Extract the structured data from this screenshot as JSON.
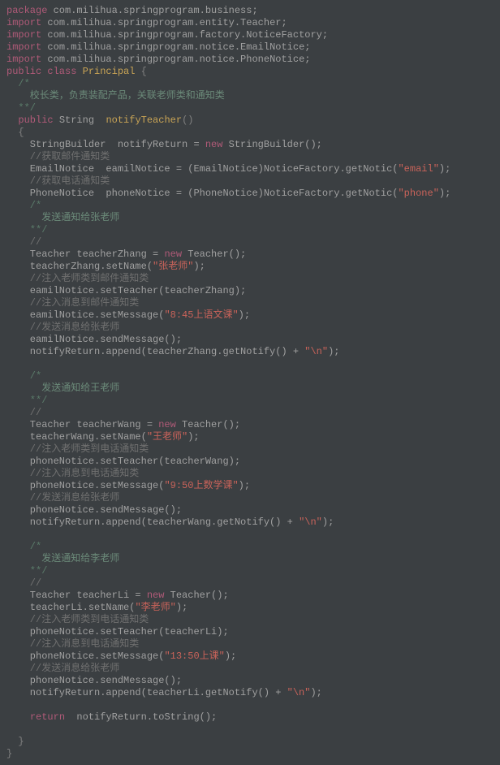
{
  "lines": [
    {
      "segments": [
        {
          "t": "package ",
          "c": "kw"
        },
        {
          "t": "com.milihua.springprogram.business;",
          "c": "pkg"
        }
      ]
    },
    {
      "segments": [
        {
          "t": "import ",
          "c": "kw"
        },
        {
          "t": "com.milihua.springprogram.entity.Teacher;",
          "c": "pkg"
        }
      ]
    },
    {
      "segments": [
        {
          "t": "import ",
          "c": "kw"
        },
        {
          "t": "com.milihua.springprogram.factory.NoticeFactory;",
          "c": "pkg"
        }
      ]
    },
    {
      "segments": [
        {
          "t": "import ",
          "c": "kw"
        },
        {
          "t": "com.milihua.springprogram.notice.EmailNotice;",
          "c": "pkg"
        }
      ]
    },
    {
      "segments": [
        {
          "t": "import ",
          "c": "kw"
        },
        {
          "t": "com.milihua.springprogram.notice.PhoneNotice;",
          "c": "pkg"
        }
      ]
    },
    {
      "segments": [
        {
          "t": "public class ",
          "c": "kw"
        },
        {
          "t": "Principal",
          "c": "cls"
        },
        {
          "t": " {",
          "c": "punc"
        }
      ]
    },
    {
      "segments": [
        {
          "t": "  /*",
          "c": "cmtblock"
        }
      ]
    },
    {
      "segments": [
        {
          "t": "    校长类，负责装配产品，关联老师类和通知类",
          "c": "cmtzh"
        }
      ]
    },
    {
      "segments": [
        {
          "t": "  **/",
          "c": "cmtblock"
        }
      ]
    },
    {
      "segments": [
        {
          "t": "  ",
          "c": "ident"
        },
        {
          "t": "public",
          "c": "kw"
        },
        {
          "t": " String  ",
          "c": "ident"
        },
        {
          "t": "notifyTeacher",
          "c": "cls"
        },
        {
          "t": "()",
          "c": "punc"
        }
      ]
    },
    {
      "segments": [
        {
          "t": "  {",
          "c": "punc"
        }
      ]
    },
    {
      "segments": [
        {
          "t": "    StringBuilder  notifyReturn = ",
          "c": "ident"
        },
        {
          "t": "new",
          "c": "kw"
        },
        {
          "t": " StringBuilder();",
          "c": "ident"
        }
      ]
    },
    {
      "segments": [
        {
          "t": "    //获取邮件通知类",
          "c": "cmtline"
        }
      ]
    },
    {
      "segments": [
        {
          "t": "    EmailNotice  eamilNotice = (EmailNotice)NoticeFactory.getNotic(",
          "c": "ident"
        },
        {
          "t": "\"email\"",
          "c": "str"
        },
        {
          "t": ");",
          "c": "ident"
        }
      ]
    },
    {
      "segments": [
        {
          "t": "    //获取电话通知类",
          "c": "cmtline"
        }
      ]
    },
    {
      "segments": [
        {
          "t": "    PhoneNotice  phoneNotice = (PhoneNotice)NoticeFactory.getNotic(",
          "c": "ident"
        },
        {
          "t": "\"phone\"",
          "c": "str"
        },
        {
          "t": ");",
          "c": "ident"
        }
      ]
    },
    {
      "segments": [
        {
          "t": "    /*",
          "c": "cmtblock"
        }
      ]
    },
    {
      "segments": [
        {
          "t": "      发送通知给张老师",
          "c": "cmtzh"
        }
      ]
    },
    {
      "segments": [
        {
          "t": "    **/",
          "c": "cmtblock"
        }
      ]
    },
    {
      "segments": [
        {
          "t": "    //",
          "c": "cmtline"
        }
      ]
    },
    {
      "segments": [
        {
          "t": "    Teacher teacherZhang = ",
          "c": "ident"
        },
        {
          "t": "new",
          "c": "kw"
        },
        {
          "t": " Teacher();",
          "c": "ident"
        }
      ]
    },
    {
      "segments": [
        {
          "t": "    teacherZhang.setName(",
          "c": "ident"
        },
        {
          "t": "\"张老师\"",
          "c": "str"
        },
        {
          "t": ");",
          "c": "ident"
        }
      ]
    },
    {
      "segments": [
        {
          "t": "    //注入老师类到邮件通知类",
          "c": "cmtline"
        }
      ]
    },
    {
      "segments": [
        {
          "t": "    eamilNotice.setTeacher(teacherZhang);",
          "c": "ident"
        }
      ]
    },
    {
      "segments": [
        {
          "t": "    //注入消息到邮件通知类",
          "c": "cmtline"
        }
      ]
    },
    {
      "segments": [
        {
          "t": "    eamilNotice.setMessage(",
          "c": "ident"
        },
        {
          "t": "\"8:45上语文课\"",
          "c": "str"
        },
        {
          "t": ");",
          "c": "ident"
        }
      ]
    },
    {
      "segments": [
        {
          "t": "    //发送消息给张老师",
          "c": "cmtline"
        }
      ]
    },
    {
      "segments": [
        {
          "t": "    eamilNotice.sendMessage();",
          "c": "ident"
        }
      ]
    },
    {
      "segments": [
        {
          "t": "    notifyReturn.append(teacherZhang.getNotify() + ",
          "c": "ident"
        },
        {
          "t": "\"\\n\"",
          "c": "str"
        },
        {
          "t": ");",
          "c": "ident"
        }
      ]
    },
    {
      "segments": [
        {
          "t": " ",
          "c": "ident"
        }
      ]
    },
    {
      "segments": [
        {
          "t": "    /*",
          "c": "cmtblock"
        }
      ]
    },
    {
      "segments": [
        {
          "t": "      发送通知给王老师",
          "c": "cmtzh"
        }
      ]
    },
    {
      "segments": [
        {
          "t": "    **/",
          "c": "cmtblock"
        }
      ]
    },
    {
      "segments": [
        {
          "t": "    //",
          "c": "cmtline"
        }
      ]
    },
    {
      "segments": [
        {
          "t": "    Teacher teacherWang = ",
          "c": "ident"
        },
        {
          "t": "new",
          "c": "kw"
        },
        {
          "t": " Teacher();",
          "c": "ident"
        }
      ]
    },
    {
      "segments": [
        {
          "t": "    teacherWang.setName(",
          "c": "ident"
        },
        {
          "t": "\"王老师\"",
          "c": "str"
        },
        {
          "t": ");",
          "c": "ident"
        }
      ]
    },
    {
      "segments": [
        {
          "t": "    //注入老师类到电话通知类",
          "c": "cmtline"
        }
      ]
    },
    {
      "segments": [
        {
          "t": "    phoneNotice.setTeacher(teacherWang);",
          "c": "ident"
        }
      ]
    },
    {
      "segments": [
        {
          "t": "    //注入消息到电话通知类",
          "c": "cmtline"
        }
      ]
    },
    {
      "segments": [
        {
          "t": "    phoneNotice.setMessage(",
          "c": "ident"
        },
        {
          "t": "\"9:50上数学课\"",
          "c": "str"
        },
        {
          "t": ");",
          "c": "ident"
        }
      ]
    },
    {
      "segments": [
        {
          "t": "    //发送消息给张老师",
          "c": "cmtline"
        }
      ]
    },
    {
      "segments": [
        {
          "t": "    phoneNotice.sendMessage();",
          "c": "ident"
        }
      ]
    },
    {
      "segments": [
        {
          "t": "    notifyReturn.append(teacherWang.getNotify() + ",
          "c": "ident"
        },
        {
          "t": "\"\\n\"",
          "c": "str"
        },
        {
          "t": ");",
          "c": "ident"
        }
      ]
    },
    {
      "segments": [
        {
          "t": " ",
          "c": "ident"
        }
      ]
    },
    {
      "segments": [
        {
          "t": "    /*",
          "c": "cmtblock"
        }
      ]
    },
    {
      "segments": [
        {
          "t": "      发送通知给李老师",
          "c": "cmtzh"
        }
      ]
    },
    {
      "segments": [
        {
          "t": "    **/",
          "c": "cmtblock"
        }
      ]
    },
    {
      "segments": [
        {
          "t": "    //",
          "c": "cmtline"
        }
      ]
    },
    {
      "segments": [
        {
          "t": "    Teacher teacherLi = ",
          "c": "ident"
        },
        {
          "t": "new",
          "c": "kw"
        },
        {
          "t": " Teacher();",
          "c": "ident"
        }
      ]
    },
    {
      "segments": [
        {
          "t": "    teacherLi.setName(",
          "c": "ident"
        },
        {
          "t": "\"李老师\"",
          "c": "str"
        },
        {
          "t": ");",
          "c": "ident"
        }
      ]
    },
    {
      "segments": [
        {
          "t": "    //注入老师类到电话通知类",
          "c": "cmtline"
        }
      ]
    },
    {
      "segments": [
        {
          "t": "    phoneNotice.setTeacher(teacherLi);",
          "c": "ident"
        }
      ]
    },
    {
      "segments": [
        {
          "t": "    //注入消息到电话通知类",
          "c": "cmtline"
        }
      ]
    },
    {
      "segments": [
        {
          "t": "    phoneNotice.setMessage(",
          "c": "ident"
        },
        {
          "t": "\"13:50上课\"",
          "c": "str"
        },
        {
          "t": ");",
          "c": "ident"
        }
      ]
    },
    {
      "segments": [
        {
          "t": "    //发送消息给张老师",
          "c": "cmtline"
        }
      ]
    },
    {
      "segments": [
        {
          "t": "    phoneNotice.sendMessage();",
          "c": "ident"
        }
      ]
    },
    {
      "segments": [
        {
          "t": "    notifyReturn.append(teacherLi.getNotify() + ",
          "c": "ident"
        },
        {
          "t": "\"\\n\"",
          "c": "str"
        },
        {
          "t": ");",
          "c": "ident"
        }
      ]
    },
    {
      "segments": [
        {
          "t": " ",
          "c": "ident"
        }
      ]
    },
    {
      "segments": [
        {
          "t": "    ",
          "c": "ident"
        },
        {
          "t": "return",
          "c": "kw"
        },
        {
          "t": "  notifyReturn.toString();",
          "c": "ident"
        }
      ]
    },
    {
      "segments": [
        {
          "t": " ",
          "c": "ident"
        }
      ]
    },
    {
      "segments": [
        {
          "t": "  }",
          "c": "punc"
        }
      ]
    },
    {
      "segments": [
        {
          "t": "}",
          "c": "punc"
        }
      ]
    }
  ]
}
